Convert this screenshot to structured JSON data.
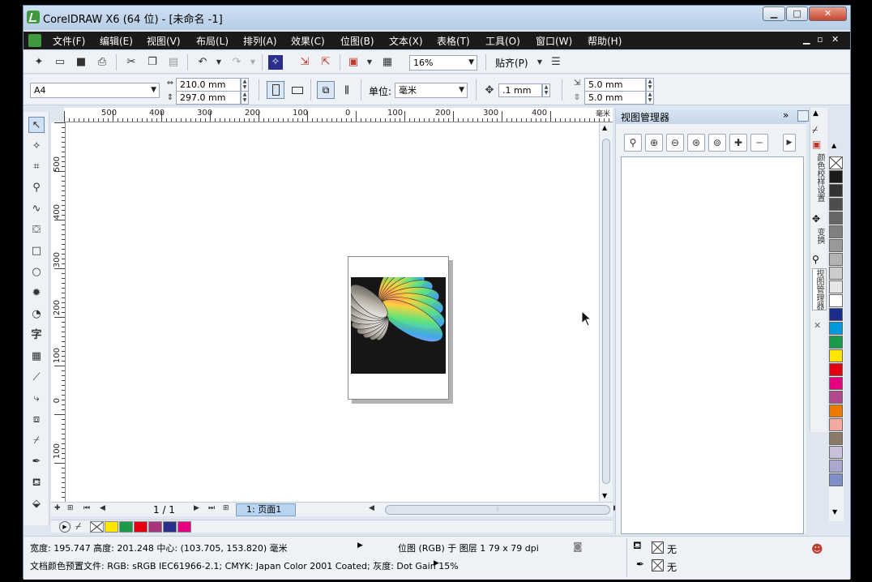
{
  "window": {
    "title": "CorelDRAW X6 (64 位) - [未命名 -1]",
    "minimize": "▁",
    "maximize": "□",
    "close": "✕"
  },
  "menu": {
    "items": [
      "文件(F)",
      "编辑(E)",
      "视图(V)",
      "布局(L)",
      "排列(A)",
      "效果(C)",
      "位图(B)",
      "文本(X)",
      "表格(T)",
      "工具(O)",
      "窗口(W)",
      "帮助(H)"
    ],
    "mdi_min": "▁",
    "mdi_restore": "▫",
    "mdi_close": "✕"
  },
  "toolbar": {
    "zoom": "16%",
    "snap_label": "贴齐(P)"
  },
  "property_bar": {
    "paper_size": "A4",
    "width": "210.0 mm",
    "height": "297.0 mm",
    "unit_label": "单位:",
    "unit": "毫米",
    "nudge": ".1 mm",
    "dup_x": "5.0 mm",
    "dup_y": "5.0 mm"
  },
  "rulers": {
    "h_labels": [
      "500",
      "400",
      "300",
      "200",
      "100",
      "0",
      "100",
      "200",
      "300",
      "400"
    ],
    "v_labels": [
      "500",
      "400",
      "300",
      "200",
      "100",
      "0",
      "100"
    ],
    "unit": "毫米"
  },
  "navigator": {
    "page_count": "1 / 1",
    "page_tab": "1: 页面1"
  },
  "docker": {
    "title": "视图管理器",
    "expand": "»",
    "close": "✕"
  },
  "vertical_tabs": {
    "color_manager": "颜色校样设置",
    "transform": "变换",
    "view_manager": "视图管理器"
  },
  "status": {
    "dimensions": "宽度: 195.747  高度: 201.248  中心: (103.705, 153.820)  毫米",
    "object_info": "位图 (RGB) 于 图层 1 79 x 79 dpi",
    "color_profile": "文档颜色预置文件: RGB: sRGB IEC61966-2.1; CMYK: Japan Color 2001 Coated; 灰度: Dot Gain 15%",
    "fill_none": "无",
    "outline_none": "无"
  },
  "doc_palette_colors": [
    "#ffe600",
    "#1a9b4a",
    "#e60012",
    "#a8347a",
    "#2b2f8c",
    "#e4007f"
  ],
  "palette_colors": [
    "#1a1a1a",
    "#333333",
    "#4d4d4d",
    "#666666",
    "#808080",
    "#999999",
    "#b3b3b3",
    "#cccccc",
    "#e6e6e6",
    "#ffffff",
    "#1c2c8c",
    "#0098dc",
    "#1a9b4a",
    "#ffe600",
    "#e60012",
    "#e4007f",
    "#b04a8c",
    "#ec7a00",
    "#f3a8a0",
    "#8a7a6a",
    "#c8c0d8",
    "#a8a8d0",
    "#7f8fc8"
  ]
}
